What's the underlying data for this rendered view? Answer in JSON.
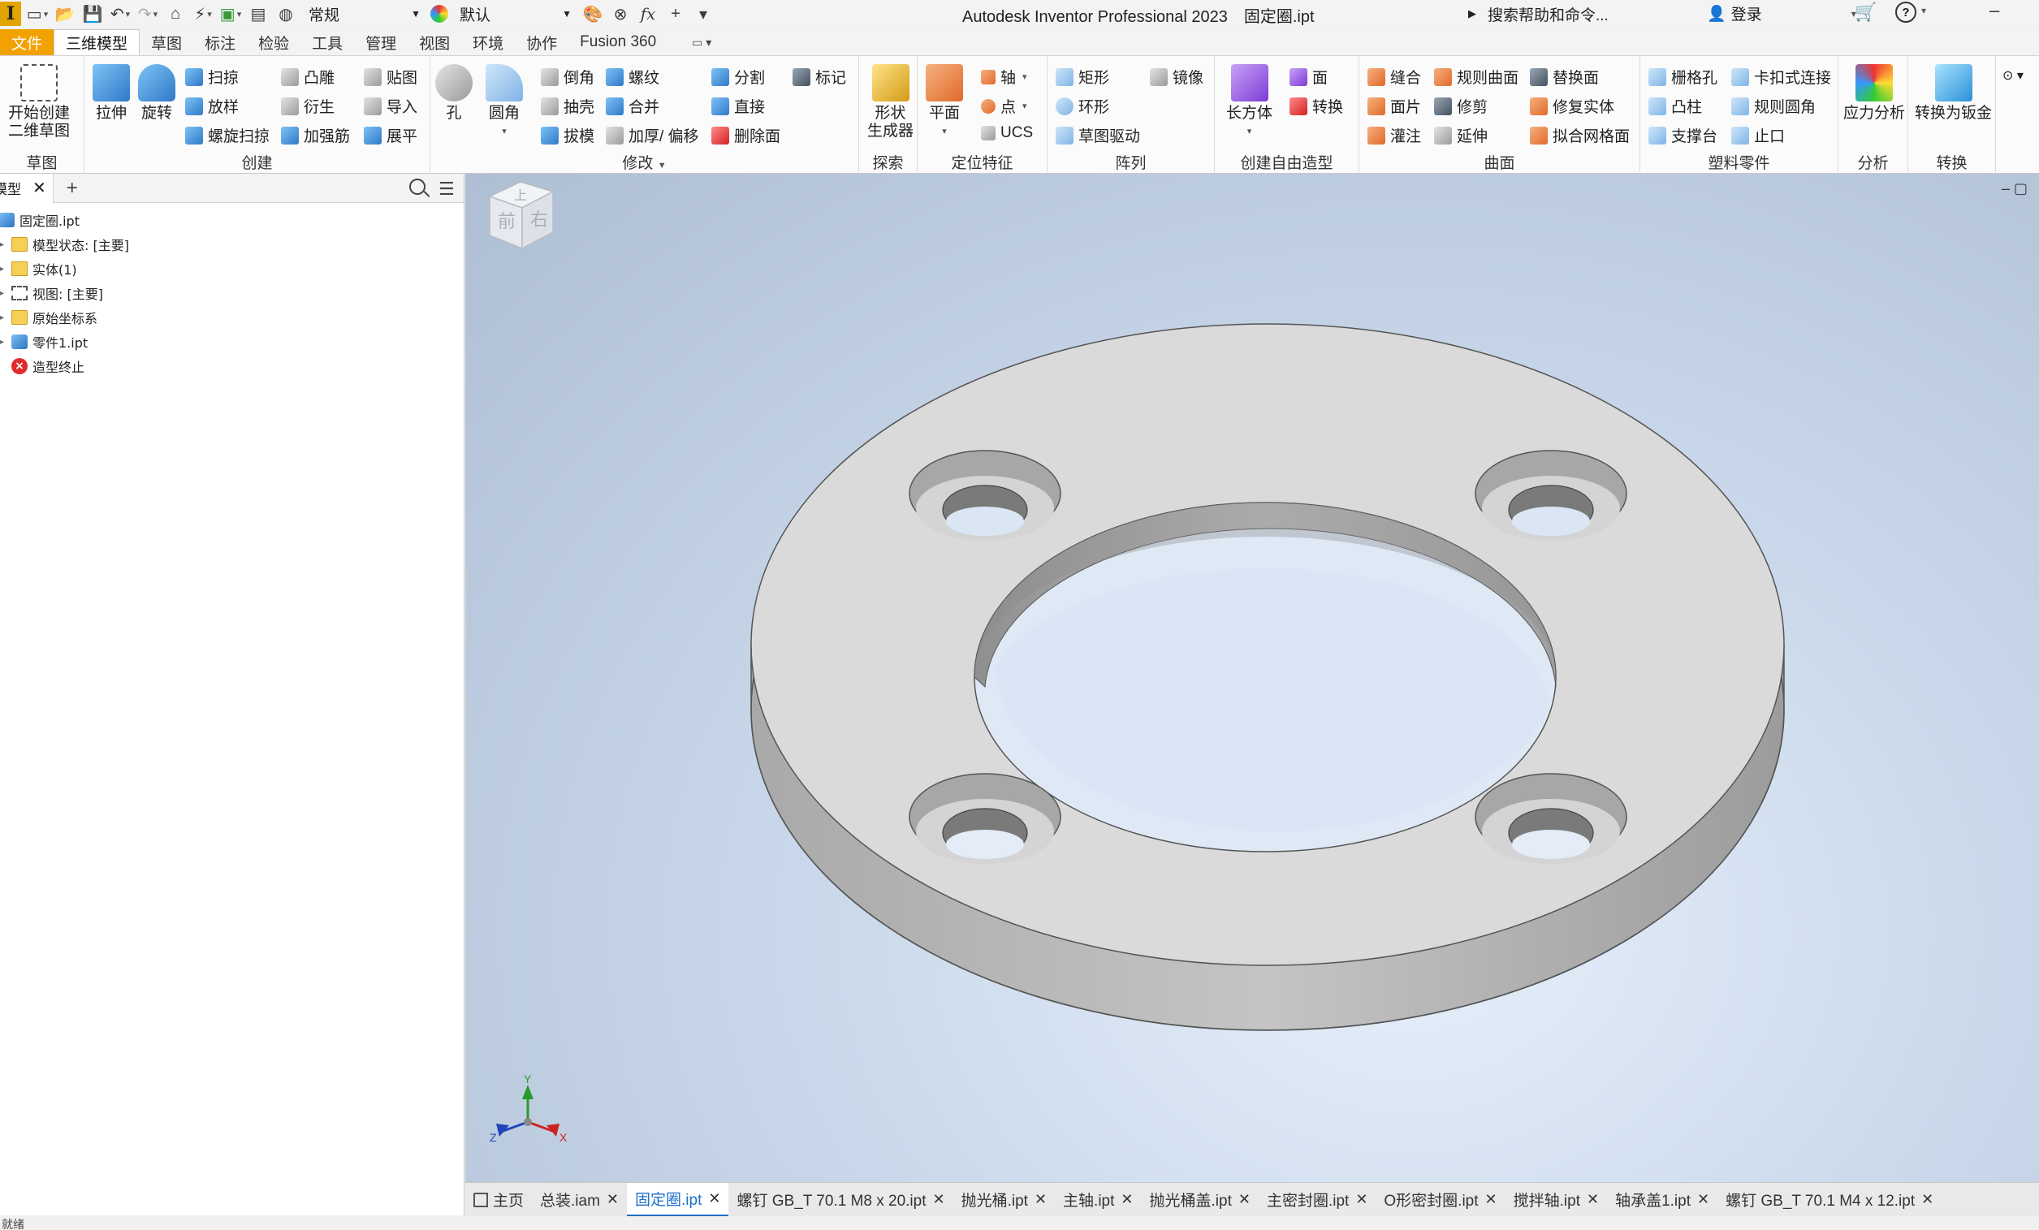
{
  "titlebar": {
    "logo": "I",
    "appearance_style": "常规",
    "material": "默认",
    "app_title": "Autodesk Inventor Professional 2023",
    "document_title": "固定圈.ipt",
    "search_placeholder": "搜索帮助和命令...",
    "login": "登录",
    "help": "?"
  },
  "tabs": [
    "文件",
    "三维模型",
    "草图",
    "标注",
    "检验",
    "工具",
    "管理",
    "视图",
    "环境",
    "协作",
    "Fusion 360"
  ],
  "active_tab": "三维模型",
  "ribbon": {
    "sketch": {
      "title": "草图",
      "start": "开始创建",
      "start2": "二维草图"
    },
    "create": {
      "title": "创建",
      "extrude": "拉伸",
      "revolve": "旋转",
      "sweep": "扫掠",
      "loft": "放样",
      "coil": "螺旋扫掠",
      "emboss": "凸雕",
      "derive": "衍生",
      "rib": "加强筋",
      "decal": "贴图",
      "import": "导入",
      "unfold": "展平"
    },
    "modify": {
      "title": "修改",
      "hole": "孔",
      "fillet": "圆角",
      "chamfer": "倒角",
      "shell": "抽壳",
      "draft": "拔模",
      "thread": "螺纹",
      "combine": "合并",
      "thicken": "加厚/ 偏移",
      "split": "分割",
      "direct": "直接",
      "delete_face": "删除面",
      "mark": "标记"
    },
    "explore": {
      "title": "探索",
      "shape_gen": "形状",
      "shape_gen2": "生成器"
    },
    "work": {
      "title": "定位特征",
      "plane": "平面",
      "axis": "轴",
      "point": "点",
      "ucs": "UCS"
    },
    "pattern": {
      "title": "阵列",
      "rect": "矩形",
      "circ": "环形",
      "sketch_driven": "草图驱动",
      "mirror": "镜像"
    },
    "freeform": {
      "title": "创建自由造型",
      "box": "长方体",
      "face": "面",
      "convert": "转换"
    },
    "surface": {
      "title": "曲面",
      "stitch": "缝合",
      "patch": "面片",
      "sculpt": "灌注",
      "ruled": "规则曲面",
      "trim": "修剪",
      "extend": "延伸",
      "replace": "替换面",
      "repair": "修复实体",
      "mesh": "拟合网格面"
    },
    "plastic": {
      "title": "塑料零件",
      "grill": "栅格孔",
      "boss": "凸柱",
      "rest": "支撑台",
      "snap": "卡扣式连接",
      "rule_fillet": "规则圆角",
      "lip": "止口"
    },
    "analysis": {
      "title": "分析",
      "stress": "应力分析"
    },
    "convert": {
      "title": "转换",
      "sheetmetal": "转换为钣金"
    }
  },
  "browser": {
    "tab_label": "模型",
    "tree": [
      {
        "label": "固定圈.ipt",
        "icon": "part"
      },
      {
        "label": "模型状态: [主要]",
        "icon": "folder"
      },
      {
        "label": "实体(1)",
        "icon": "solid"
      },
      {
        "label": "视图: [主要]",
        "icon": "view"
      },
      {
        "label": "原始坐标系",
        "icon": "folder"
      },
      {
        "label": "零件1.ipt",
        "icon": "part"
      },
      {
        "label": "造型终止",
        "icon": "stop"
      }
    ]
  },
  "viewcube": {
    "top": "上",
    "front": "前",
    "right": "右"
  },
  "axes": {
    "x": "X",
    "y": "Y",
    "z": "Z"
  },
  "doc_tabs": [
    "主页",
    "总装.iam",
    "固定圈.ipt",
    "螺钉 GB_T 70.1 M8 x 20.ipt",
    "抛光桶.ipt",
    "主轴.ipt",
    "抛光桶盖.ipt",
    "主密封圈.ipt",
    "O形密封圈.ipt",
    "搅拌轴.ipt",
    "轴承盖1.ipt",
    "螺钉 GB_T 70.1 M4 x 12.ipt"
  ],
  "active_doc": "固定圈.ipt",
  "status": "就绪",
  "colors": {
    "file_tab": "#f2a200",
    "active_doc": "#1e6fc9",
    "part_face": "#dadada",
    "part_side": "#b5b5b5"
  }
}
